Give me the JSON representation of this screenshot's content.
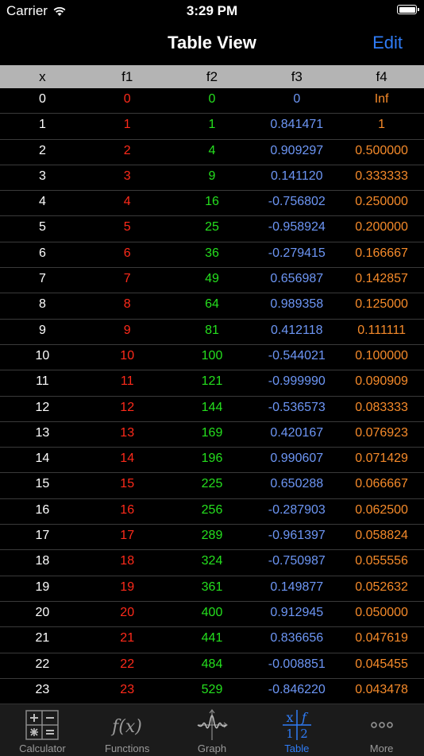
{
  "status": {
    "carrier": "Carrier",
    "time": "3:29 PM"
  },
  "nav": {
    "title": "Table View",
    "edit_label": "Edit"
  },
  "columns": [
    "x",
    "f1",
    "f2",
    "f3",
    "f4"
  ],
  "rows": [
    [
      "0",
      "0",
      "0",
      "0",
      "Inf"
    ],
    [
      "1",
      "1",
      "1",
      "0.841471",
      "1"
    ],
    [
      "2",
      "2",
      "4",
      "0.909297",
      "0.500000"
    ],
    [
      "3",
      "3",
      "9",
      "0.141120",
      "0.333333"
    ],
    [
      "4",
      "4",
      "16",
      "-0.756802",
      "0.250000"
    ],
    [
      "5",
      "5",
      "25",
      "-0.958924",
      "0.200000"
    ],
    [
      "6",
      "6",
      "36",
      "-0.279415",
      "0.166667"
    ],
    [
      "7",
      "7",
      "49",
      "0.656987",
      "0.142857"
    ],
    [
      "8",
      "8",
      "64",
      "0.989358",
      "0.125000"
    ],
    [
      "9",
      "9",
      "81",
      "0.412118",
      "0.111111"
    ],
    [
      "10",
      "10",
      "100",
      "-0.544021",
      "0.100000"
    ],
    [
      "11",
      "11",
      "121",
      "-0.999990",
      "0.090909"
    ],
    [
      "12",
      "12",
      "144",
      "-0.536573",
      "0.083333"
    ],
    [
      "13",
      "13",
      "169",
      "0.420167",
      "0.076923"
    ],
    [
      "14",
      "14",
      "196",
      "0.990607",
      "0.071429"
    ],
    [
      "15",
      "15",
      "225",
      "0.650288",
      "0.066667"
    ],
    [
      "16",
      "16",
      "256",
      "-0.287903",
      "0.062500"
    ],
    [
      "17",
      "17",
      "289",
      "-0.961397",
      "0.058824"
    ],
    [
      "18",
      "18",
      "324",
      "-0.750987",
      "0.055556"
    ],
    [
      "19",
      "19",
      "361",
      "0.149877",
      "0.052632"
    ],
    [
      "20",
      "20",
      "400",
      "0.912945",
      "0.050000"
    ],
    [
      "21",
      "21",
      "441",
      "0.836656",
      "0.047619"
    ],
    [
      "22",
      "22",
      "484",
      "-0.008851",
      "0.045455"
    ],
    [
      "23",
      "23",
      "529",
      "-0.846220",
      "0.043478"
    ]
  ],
  "tabs": {
    "calculator": "Calculator",
    "functions": "Functions",
    "functions_icon_text": "f(x)",
    "graph": "Graph",
    "table": "Table",
    "more": "More"
  },
  "colors": {
    "accent": "#2f7cf6",
    "f1": "#ff2a1a",
    "f2": "#25e01e",
    "f3": "#6d96f5",
    "f4": "#f58a2a"
  }
}
